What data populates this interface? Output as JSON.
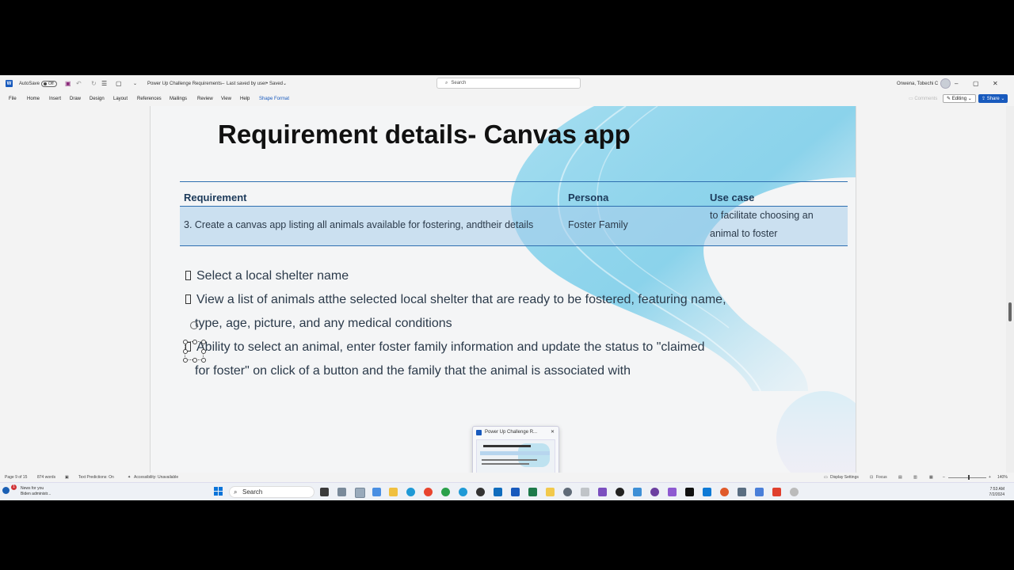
{
  "titlebar": {
    "autosave_label": "AutoSave",
    "autosave_state": "Off",
    "document_title": "Power Up Challenge Requirements",
    "save_status": "Last saved by user",
    "saved_label": "Saved",
    "search_placeholder": "Search",
    "user_name": "Onwena, Tobechi C"
  },
  "menu": {
    "tabs": [
      "File",
      "Home",
      "Insert",
      "Draw",
      "Design",
      "Layout",
      "References",
      "Mailings",
      "Review",
      "View",
      "Help",
      "Shape Format"
    ],
    "comments_label": "Comments",
    "editing_label": "Editing",
    "share_label": "Share"
  },
  "slide": {
    "title": "Requirement details- Canvas app",
    "table": {
      "headers": [
        "Requirement",
        "Persona",
        "Use case"
      ],
      "row": {
        "requirement": "3.  Create a canvas app listing all animals available for fostering, andtheir details",
        "persona": "Foster Family",
        "use_case_line1": "to facilitate choosing an",
        "use_case_line2": "animal to foster"
      }
    },
    "bullets": {
      "b1": "Select a local shelter name",
      "b2_line1": "View a list of animals atthe selected local shelter that are ready to be fostered, featuring name,",
      "b2_line2": "type, age, picture, and any medical conditions",
      "b3_line1": "Ability to select an animal, enter foster family information and update the status to \"claimed",
      "b3_line2": "for foster\" on click of a button and the family that the animal is associated with"
    }
  },
  "statusbar": {
    "page": "Page 9 of 15",
    "words": "874 words",
    "predictions": "Text Predictions: On",
    "accessibility": "Accessibility: Unavailable",
    "display_settings": "Display Settings",
    "focus": "Focus",
    "zoom": "140%"
  },
  "taskbar": {
    "news_title": "News for you",
    "news_sub": "Biden administr...",
    "search_label": "Search",
    "preview_title": "Power Up Challenge R...",
    "time": "7:53 AM",
    "date": "7/2/2024",
    "news_badge": "1"
  },
  "colors": {
    "word_blue": "#185abd",
    "table_line": "#2e6fb0",
    "table_row": "#b7d5ee"
  }
}
